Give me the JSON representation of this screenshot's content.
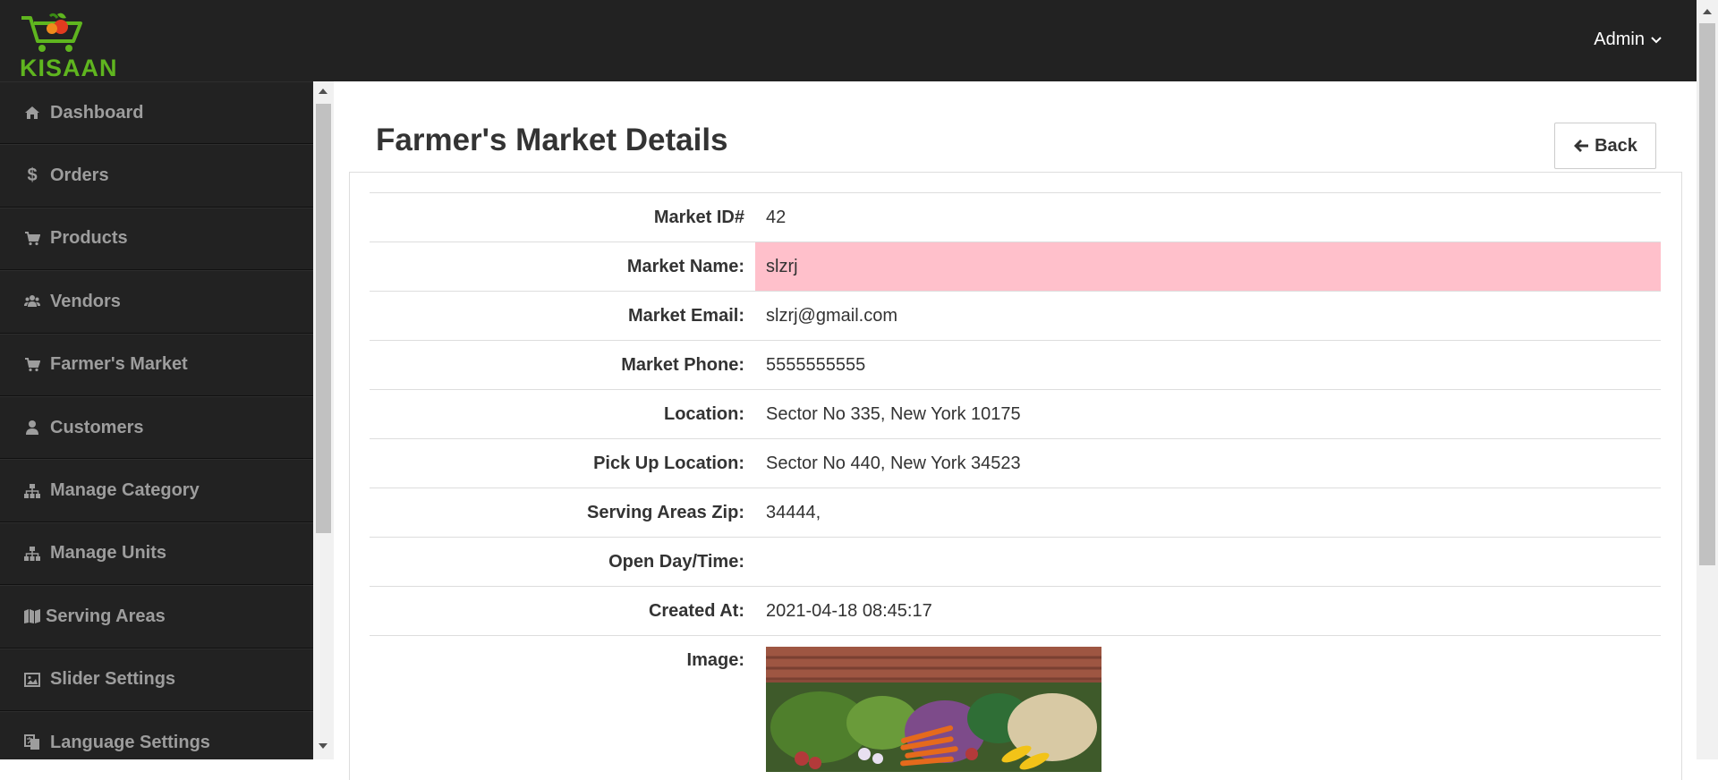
{
  "header": {
    "logo_text": "KISAAN",
    "user_menu_label": "Admin"
  },
  "sidebar": {
    "items": [
      {
        "label": "Dashboard",
        "icon": "home-icon"
      },
      {
        "label": "Orders",
        "icon": "dollar-icon"
      },
      {
        "label": "Products",
        "icon": "cart-icon"
      },
      {
        "label": "Vendors",
        "icon": "users-icon"
      },
      {
        "label": "Farmer's Market",
        "icon": "cart-icon"
      },
      {
        "label": "Customers",
        "icon": "user-icon"
      },
      {
        "label": "Manage Category",
        "icon": "sitemap-icon"
      },
      {
        "label": "Manage Units",
        "icon": "sitemap-icon"
      },
      {
        "label": "Serving Areas",
        "icon": "map-icon"
      },
      {
        "label": "Slider Settings",
        "icon": "image-icon"
      },
      {
        "label": "Language Settings",
        "icon": "language-icon"
      }
    ]
  },
  "main": {
    "title": "Farmer's Market Details",
    "back_label": "Back",
    "details": [
      {
        "label": "Market ID#",
        "value": "42"
      },
      {
        "label": "Market Name:",
        "value": "slzrj"
      },
      {
        "label": "Market Email:",
        "value": "slzrj@gmail.com"
      },
      {
        "label": "Market Phone:",
        "value": "5555555555"
      },
      {
        "label": "Location:",
        "value": "Sector No 335, New York 10175"
      },
      {
        "label": "Pick Up Location:",
        "value": "Sector No 440, New York 34523"
      },
      {
        "label": "Serving Areas Zip:",
        "value": "34444,"
      },
      {
        "label": "Open Day/Time:",
        "value": ""
      },
      {
        "label": "Created At:",
        "value": "2021-04-18 08:45:17"
      },
      {
        "label": "Image:"
      }
    ]
  },
  "colors": {
    "topbar": "#222222",
    "sidebar_text": "#9d9d9d",
    "highlight_row": "#ffc0cb",
    "logo_green": "#5fb51f"
  }
}
